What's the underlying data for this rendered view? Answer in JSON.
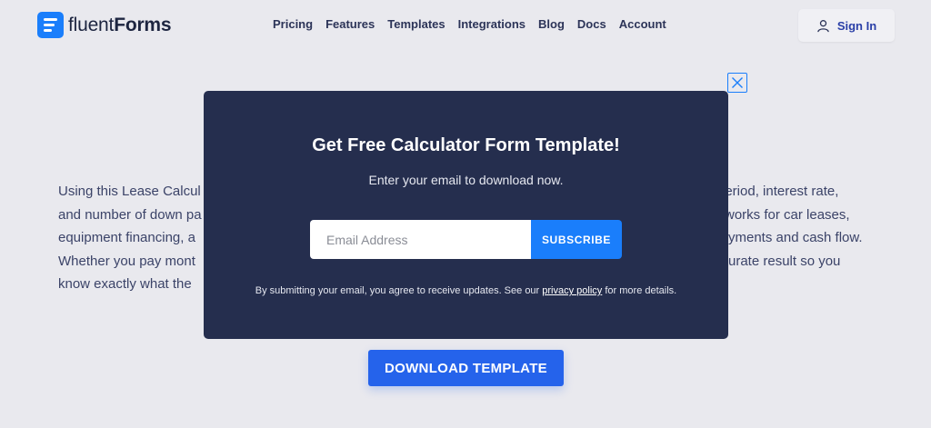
{
  "brand": {
    "name_light": "fluent",
    "name_bold": "Forms",
    "accent": "#1a7efb"
  },
  "nav": {
    "items": [
      {
        "label": "Pricing"
      },
      {
        "label": "Features"
      },
      {
        "label": "Templates"
      },
      {
        "label": "Integrations"
      },
      {
        "label": "Blog"
      },
      {
        "label": "Docs"
      },
      {
        "label": "Account"
      }
    ]
  },
  "header": {
    "signin_label": "Sign In",
    "signin_icon": "user-icon"
  },
  "content": {
    "lines": [
      "Using this Lease Calcul",
      "and number of down pa",
      "equipment financing, a",
      "Whether you pay mont",
      "know exactly what the"
    ],
    "lines_right": [
      "period, interest rate,",
      "works for car leases,",
      "yments and cash flow.",
      "urate result so you"
    ],
    "download_label": "DOWNLOAD TEMPLATE"
  },
  "modal": {
    "title": "Get Free Calculator Form Template!",
    "subtitle": "Enter your email to download now.",
    "email_placeholder": "Email Address",
    "subscribe_label": "SUBSCRIBE",
    "note_before": "By submitting your email, you agree to receive updates. See our ",
    "note_link": "privacy policy",
    "note_after": " for more details.",
    "close_icon": "close-icon",
    "bg_color": "#252e4e",
    "button_color": "#1a7efb"
  }
}
